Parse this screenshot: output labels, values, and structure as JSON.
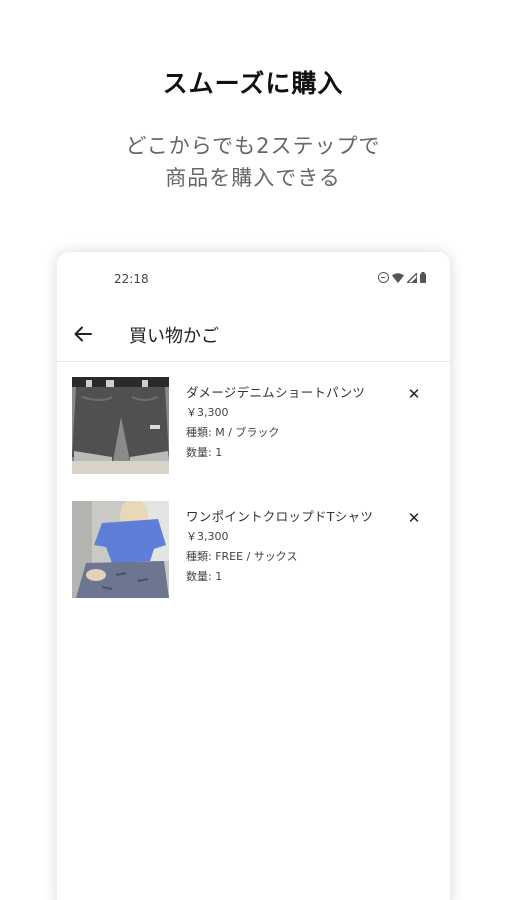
{
  "promo": {
    "title": "スムーズに購入",
    "subtitle_line1": "どこからでも2ステップで",
    "subtitle_line2": "商品を購入できる"
  },
  "status_bar": {
    "time": "22:18"
  },
  "app_bar": {
    "title": "買い物かご"
  },
  "cart": {
    "items": [
      {
        "name": "ダメージデニムショートパンツ",
        "price": "￥3,300",
        "variant": "種類: M / ブラック",
        "quantity": "数量: 1",
        "image_icon": "denim-shorts-photo"
      },
      {
        "name": "ワンポイントクロップドTシャツ",
        "price": "￥3,300",
        "variant": "種類: FREE / サックス",
        "quantity": "数量: 1",
        "image_icon": "cropped-tshirt-photo"
      }
    ],
    "remove_glyph": "✕"
  },
  "colors": {
    "background": "#ffffff",
    "card_shadow": "#d0d0d0",
    "title_text": "#111111",
    "subtitle_text": "#666666"
  }
}
